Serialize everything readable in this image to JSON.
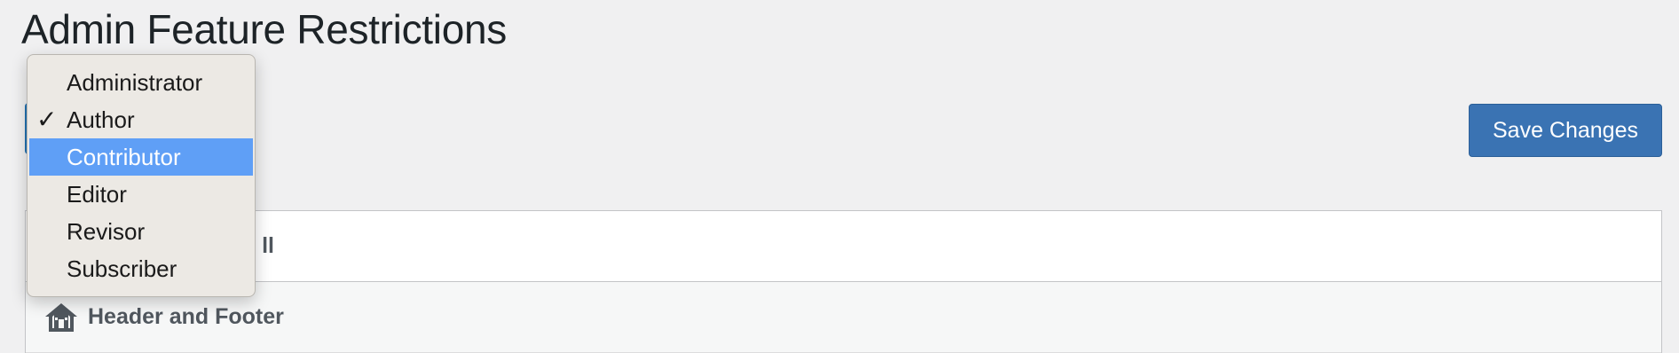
{
  "page_title": "Admin Feature Restrictions",
  "save_button_label": "Save Changes",
  "role_dropdown": {
    "options": [
      "Administrator",
      "Author",
      "Contributor",
      "Editor",
      "Revisor",
      "Subscriber"
    ],
    "selected": "Author",
    "highlighted": "Contributor",
    "check_glyph": "✓"
  },
  "feature_rows": [
    {
      "label": "ll",
      "icon": null
    },
    {
      "label": "Header and Footer",
      "icon": "house-icon"
    }
  ],
  "colors": {
    "accent": "#3a73b3",
    "highlight": "#5f9ff6",
    "background": "#f0f0f1"
  }
}
